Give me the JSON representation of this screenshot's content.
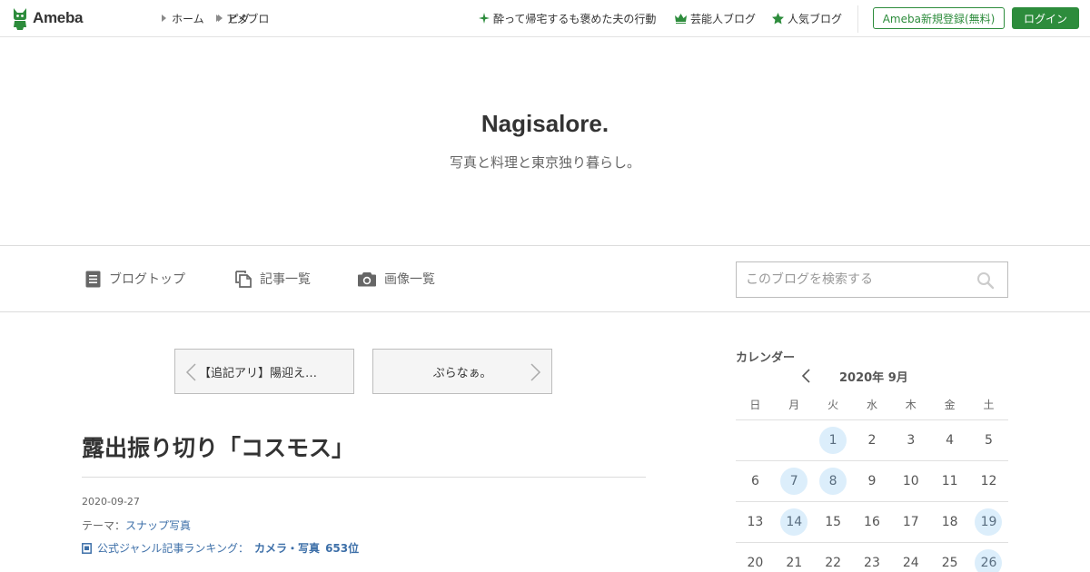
{
  "topbar": {
    "logo_text": "Ameba",
    "nav": [
      {
        "label": "ホーム"
      },
      {
        "label": "ピグ"
      },
      {
        "label": "アメブロ"
      }
    ],
    "trending": {
      "label": "酔って帰宅するも褒めた夫の行動",
      "icon": "sparkle-icon"
    },
    "celebrity_blog": {
      "label": "芸能人ブログ",
      "icon": "crown-icon"
    },
    "popular_blog": {
      "label": "人気ブログ",
      "icon": "star-icon"
    },
    "register_label": "Ameba新規登録(無料)",
    "login_label": "ログイン",
    "accent_color": "#2d8c3c"
  },
  "blog": {
    "title": "Nagisalore.",
    "description": "写真と料理と東京独り暮らし。"
  },
  "blog_nav": {
    "items": [
      {
        "label": "ブログトップ",
        "icon": "document-icon"
      },
      {
        "label": "記事一覧",
        "icon": "copy-icon"
      },
      {
        "label": "画像一覧",
        "icon": "camera-icon"
      }
    ],
    "search_placeholder": "このブログを検索する"
  },
  "entry_nav": {
    "prev_label": "【追記アリ】陽迎え…",
    "next_label": "ぷらなぁ。"
  },
  "entry": {
    "title": "露出振り切り「コスモス」",
    "date": "2020-09-27",
    "theme_prefix": "テーマ：",
    "theme": "スナップ写真",
    "ranking_prefix": "公式ジャンル記事ランキング：",
    "ranking_genre": "カメラ・写真",
    "ranking_rank": "653位",
    "link_color": "#3d6fa8"
  },
  "calendar": {
    "heading": "カレンダー",
    "month_label": "2020年 9月",
    "weekdays": [
      "日",
      "月",
      "火",
      "水",
      "木",
      "金",
      "土"
    ],
    "weeks": [
      [
        "",
        "",
        "1",
        "2",
        "3",
        "4",
        "5"
      ],
      [
        "6",
        "7",
        "8",
        "9",
        "10",
        "11",
        "12"
      ],
      [
        "13",
        "14",
        "15",
        "16",
        "17",
        "18",
        "19"
      ],
      [
        "20",
        "21",
        "22",
        "23",
        "24",
        "25",
        "26"
      ]
    ],
    "highlighted_days": [
      "1",
      "7",
      "8",
      "14",
      "19",
      "26"
    ],
    "highlight_color": "#dceefb"
  }
}
